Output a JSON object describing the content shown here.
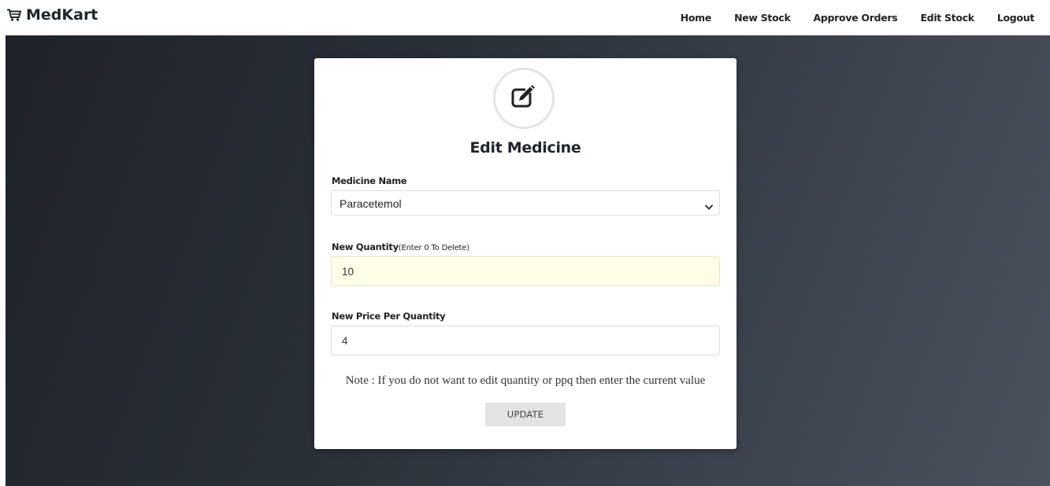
{
  "navbar": {
    "brand": "MedKart",
    "brand_icon": "shopping-cart-icon",
    "links": [
      {
        "label": "Home"
      },
      {
        "label": "New Stock"
      },
      {
        "label": "Approve Orders"
      },
      {
        "label": "Edit Stock"
      },
      {
        "label": "Logout"
      }
    ]
  },
  "form": {
    "icon": "edit-square-icon",
    "title": "Edit Medicine",
    "medicine_name": {
      "label": "Medicine Name",
      "selected": "Paracetemol"
    },
    "quantity": {
      "label": "New Quantity",
      "hint": "(Enter 0 To Delete)",
      "value": "10"
    },
    "price": {
      "label": "New Price Per Quantity",
      "value": "4"
    },
    "note": "Note : If you do not want to edit quantity or ppq then enter the current value",
    "submit_label": "UPDATE"
  }
}
